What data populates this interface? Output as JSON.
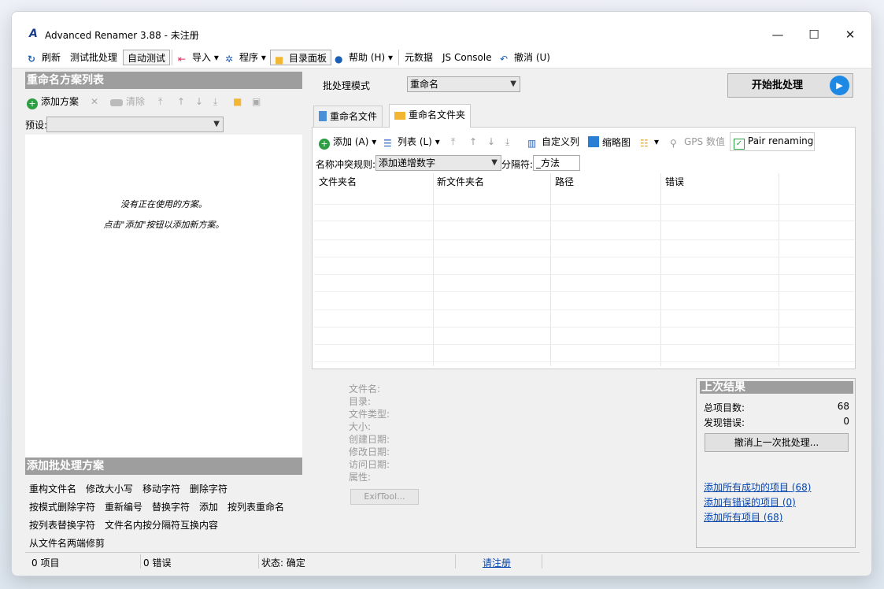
{
  "window": {
    "app_logo": "A",
    "title": "Advanced Renamer 3.88 - 未注册",
    "min": "—",
    "max": "☐",
    "close": "✕"
  },
  "toolbar": {
    "refresh": "刷新",
    "test_batch": "测试批处理",
    "auto_test": "自动测试",
    "import": "导入",
    "program": "程序",
    "dir_panel": "目录面板",
    "help": "帮助 (H)",
    "metadata": "元数据",
    "js_console": "JS Console",
    "undo": "撤消 (U)"
  },
  "left": {
    "scheme_list_title": "重命名方案列表",
    "add_scheme": "添加方案",
    "clear": "清除",
    "preset_label": "预设:",
    "preset_value": "",
    "empty_line1": "没有正在使用的方案。",
    "empty_line2": "点击\"添加\"按钮以添加新方案。",
    "add_methods_title": "添加批处理方案",
    "methods": [
      "重构文件名",
      "修改大小写",
      "移动字符",
      "删除字符",
      "按模式删除字符",
      "重新编号",
      "替换字符",
      "添加",
      "按列表重命名",
      "按列表替换字符",
      "文件名内按分隔符互换内容",
      "从文件名两端修剪"
    ]
  },
  "main": {
    "batch_mode_label": "批处理模式",
    "batch_mode_value": "重命名",
    "start_button": "开始批处理",
    "tabs": [
      {
        "label": "重命名文件"
      },
      {
        "label": "重命名文件夹"
      }
    ],
    "add": "添加 (A)",
    "list": "列表 (L)",
    "custom_columns": "自定义列",
    "thumbnails": "缩略图",
    "gps": "GPS 数值",
    "pair_renaming": "Pair renaming",
    "conflict_label": "名称冲突规则:",
    "conflict_value": "添加递增数字",
    "separator_label": "分隔符:",
    "separator_value": "_方法",
    "columns": [
      "文件夹名",
      "新文件夹名",
      "路径",
      "错误"
    ]
  },
  "props": {
    "labels": [
      "文件名:",
      "目录:",
      "文件类型:",
      "大小:",
      "创建日期:",
      "修改日期:",
      "访问日期:",
      "属性:"
    ],
    "exif_button": "ExifTool..."
  },
  "last_result": {
    "title": "上次结果",
    "total_label": "总项目数:",
    "total_value": "68",
    "errors_label": "发现错误:",
    "errors_value": "0",
    "undo_button": "撤消上一次批处理...",
    "link_success": "添加所有成功的项目 (68)",
    "link_errors": "添加有错误的项目 (0)",
    "link_all": "添加所有项目 (68)"
  },
  "status": {
    "items": "0 项目",
    "errors": "0 错误",
    "state": "状态: 确定",
    "register": "请注册"
  },
  "colors": {
    "accent_blue": "#1e88e5",
    "header_gray": "#9e9e9e",
    "link": "#0645ad"
  }
}
